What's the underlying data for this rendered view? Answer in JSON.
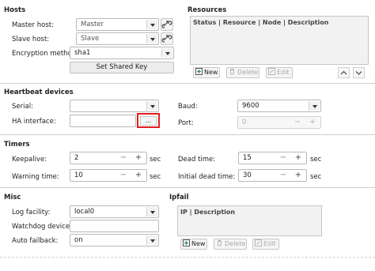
{
  "hosts": {
    "title": "Hosts",
    "master_label": "Master host:",
    "master_value": "Master",
    "slave_label": "Slave host:",
    "slave_value": "Slave",
    "encryption_label": "Encryption method:",
    "encryption_value": "sha1",
    "set_shared_key": "Set Shared Key"
  },
  "resources": {
    "title": "Resources",
    "columns": "Status | Resource    | Node   | Description",
    "new_label": "New",
    "delete_label": "Delete",
    "edit_label": "Edit"
  },
  "heartbeat": {
    "title": "Heartbeat devices",
    "serial_label": "Serial:",
    "serial_value": "",
    "ha_label": "HA interface:",
    "ha_value": "",
    "browse_label": "...",
    "baud_label": "Baud:",
    "baud_value": "9600",
    "port_label": "Port:",
    "port_value": "0"
  },
  "timers": {
    "title": "Timers",
    "keepalive_label": "Keepalive:",
    "keepalive_value": "2",
    "warning_label": "Warning time:",
    "warning_value": "10",
    "dead_label": "Dead time:",
    "dead_value": "15",
    "initial_dead_label": "Initial dead time:",
    "initial_dead_value": "30",
    "unit": "sec"
  },
  "misc": {
    "title": "Misc",
    "log_facility_label": "Log facility:",
    "log_facility_value": "local0",
    "watchdog_label": "Watchdog device:",
    "watchdog_value": "",
    "auto_failback_label": "Auto failback:",
    "auto_failback_value": "on"
  },
  "ipfail": {
    "title": "Ipfail",
    "columns": "IP | Description",
    "new_label": "New",
    "delete_label": "Delete",
    "edit_label": "Edit"
  },
  "spin_minus": "−",
  "spin_plus": "+",
  "colors": {
    "highlight": "#e01e24",
    "add_icon": "#2e8b57"
  },
  "icons": [
    "link-icon",
    "add-icon",
    "delete-icon",
    "edit-icon",
    "chevron-up-icon",
    "chevron-down-icon",
    "dropdown-arrow-icon"
  ]
}
